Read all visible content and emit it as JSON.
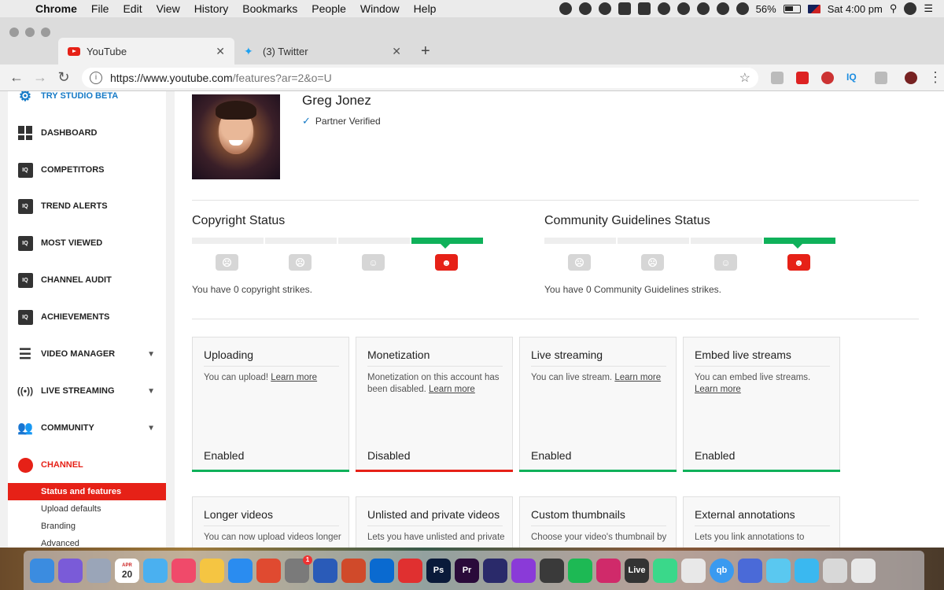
{
  "menubar": {
    "app": "Chrome",
    "items": [
      "File",
      "Edit",
      "View",
      "History",
      "Bookmarks",
      "People",
      "Window",
      "Help"
    ],
    "battery": "56%",
    "clock": "Sat 4:00 pm"
  },
  "tabs": [
    {
      "title": "YouTube",
      "active": true
    },
    {
      "title": "(3) Twitter",
      "active": false
    }
  ],
  "address": {
    "url_main": "https://www.youtube.com",
    "url_rest": "/features?ar=2&o=U"
  },
  "extensions": {
    "iq_label": "IQ"
  },
  "sidebar": {
    "items": [
      {
        "label": "TRY STUDIO BETA",
        "icon": "gear-icon"
      },
      {
        "label": "DASHBOARD",
        "icon": "dashboard-icon"
      },
      {
        "label": "COMPETITORS",
        "icon": "iq-icon"
      },
      {
        "label": "TREND ALERTS",
        "icon": "iq-icon"
      },
      {
        "label": "MOST VIEWED",
        "icon": "iq-icon"
      },
      {
        "label": "CHANNEL AUDIT",
        "icon": "iq-icon"
      },
      {
        "label": "ACHIEVEMENTS",
        "icon": "iq-icon"
      },
      {
        "label": "VIDEO MANAGER",
        "icon": "video-manager-icon"
      },
      {
        "label": "LIVE STREAMING",
        "icon": "live-icon"
      },
      {
        "label": "COMMUNITY",
        "icon": "community-icon"
      },
      {
        "label": "CHANNEL",
        "icon": "channel-icon"
      }
    ],
    "iq_text": "IQ",
    "subitems": [
      "Status and features",
      "Upload defaults",
      "Branding",
      "Advanced"
    ]
  },
  "channel": {
    "name": "Greg Jonez",
    "verified": "Partner Verified"
  },
  "copyright": {
    "title": "Copyright Status",
    "text": "You have 0 copyright strikes."
  },
  "community_status": {
    "title": "Community Guidelines Status",
    "text": "You have 0 Community Guidelines strikes."
  },
  "cards": [
    {
      "title": "Uploading",
      "desc": "You can upload! ",
      "link": "Learn more",
      "state": "Enabled",
      "color": "#0fb15a"
    },
    {
      "title": "Monetization",
      "desc": "Monetization on this account has been disabled. ",
      "link": "Learn more",
      "state": "Disabled",
      "color": "#e62117"
    },
    {
      "title": "Live streaming",
      "desc": "You can live stream. ",
      "link": "Learn more",
      "state": "Enabled",
      "color": "#0fb15a"
    },
    {
      "title": "Embed live streams",
      "desc": "You can embed live streams. ",
      "link": "Learn more",
      "state": "Enabled",
      "color": "#0fb15a"
    },
    {
      "title": "Longer videos",
      "desc": "You can now upload videos longer",
      "link": "",
      "state": "",
      "color": ""
    },
    {
      "title": "Unlisted and private videos",
      "desc": "Lets you have unlisted and private",
      "link": "",
      "state": "",
      "color": ""
    },
    {
      "title": "Custom thumbnails",
      "desc": "Choose your video's thumbnail by",
      "link": "",
      "state": "",
      "color": ""
    },
    {
      "title": "External annotations",
      "desc": "Lets you link annotations to",
      "link": "",
      "state": "",
      "color": ""
    }
  ],
  "dock": {
    "calendar_month": "APR",
    "calendar_day": "20",
    "badge": "1",
    "live_label": "Live",
    "qb_label": "qb",
    "ps_label": "Ps",
    "pr_label": "Pr",
    "colors": [
      "#3b8ce0",
      "#7a5bd8",
      "#9aa5b8",
      "#ffffff",
      "#4ab0f0",
      "#f04a6a",
      "#f5c542",
      "#2a8cf0",
      "#e04a30",
      "#7a7a7a",
      "#2a5bb8",
      "#d04a2a",
      "#0a6ad0",
      "#e03030",
      "#0a1a3a",
      "#2a0a3a",
      "#2a2a6a",
      "#8a3ad8",
      "#3a3a3a",
      "#1db954",
      "#d02a6a",
      "#333333",
      "#3ad88a",
      "#e8e8e8",
      "#3a9af0",
      "#4a6ad8",
      "#5ac8f0",
      "#3ab8f0",
      "#d8d8d8",
      "#e8e8e8"
    ]
  }
}
